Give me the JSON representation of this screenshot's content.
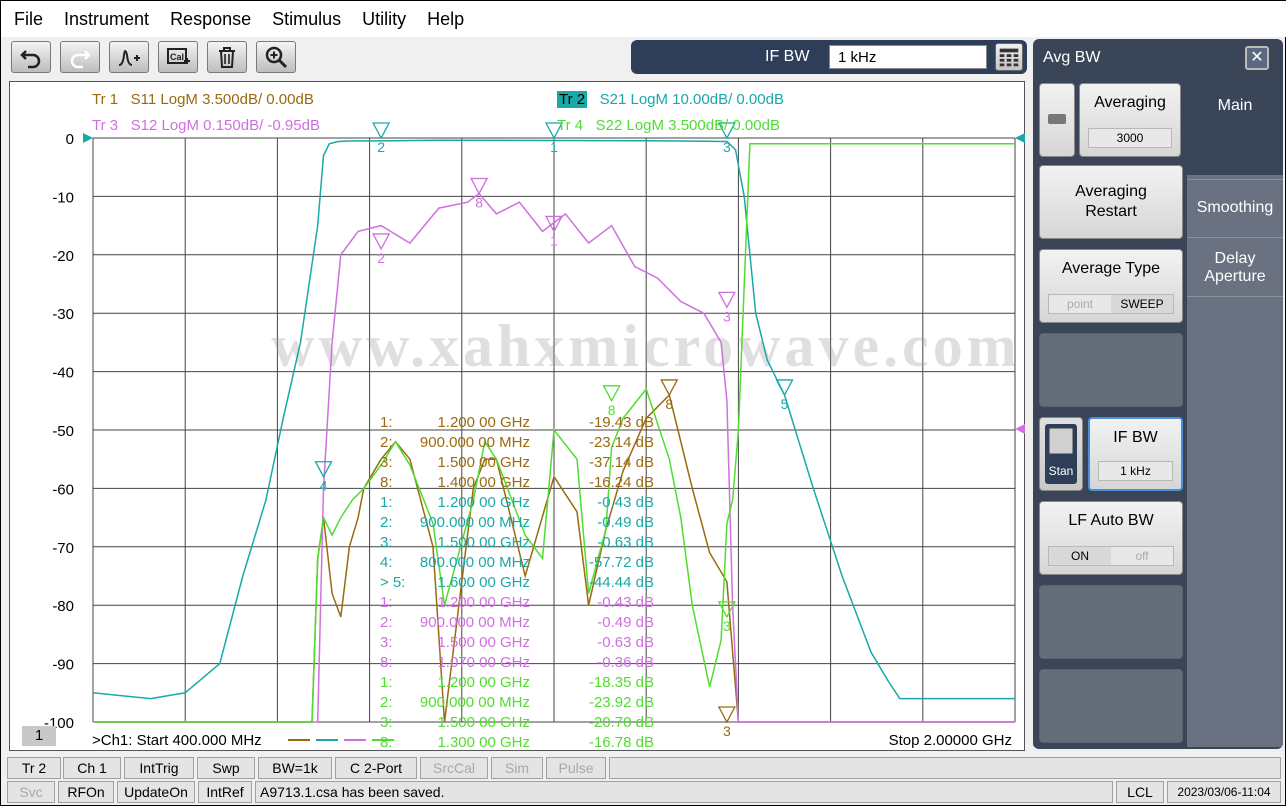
{
  "menu": [
    "File",
    "Instrument",
    "Response",
    "Stimulus",
    "Utility",
    "Help"
  ],
  "toolbar_icons": [
    "undo-icon",
    "redo-icon",
    "marker-add-icon",
    "calibration-icon",
    "trash-icon",
    "zoom-icon"
  ],
  "ifbw_bar": {
    "label": "IF BW",
    "value": "1 kHz"
  },
  "traces": [
    {
      "id": "Tr 1",
      "desc": "S11 LogM 3.500dB/  0.00dB",
      "color": "#9a6a10"
    },
    {
      "id": "Tr 2",
      "desc": "S21 LogM 10.00dB/  0.00dB",
      "color": "#1aa8a8"
    },
    {
      "id": "Tr 3",
      "desc": "S12 LogM 0.150dB/  -0.95dB",
      "color": "#d070e0"
    },
    {
      "id": "Tr 4",
      "desc": "S22 LogM 3.500dB/  0.00dB",
      "color": "#50dd30"
    }
  ],
  "watermark": "www.xahxmicrowave.com",
  "channel_box": "1",
  "start_label": ">Ch1:  Start  400.000 MHz",
  "stop_label": "Stop  2.00000 GHz",
  "marker_table": [
    {
      "n": "1:",
      "f": "1.200 00 GHz",
      "v": "-19.43 dB",
      "color": "#9a6a10"
    },
    {
      "n": "2:",
      "f": "900.000 00 MHz",
      "v": "-23.14 dB",
      "color": "#9a6a10"
    },
    {
      "n": "3:",
      "f": "1.500 00 GHz",
      "v": "-37.14 dB",
      "color": "#9a6a10"
    },
    {
      "n": "8:",
      "f": "1.400 00 GHz",
      "v": "-16.24 dB",
      "color": "#9a6a10"
    },
    {
      "n": "1:",
      "f": "1.200 00 GHz",
      "v": "-0.43 dB",
      "color": "#1aa8a8"
    },
    {
      "n": "2:",
      "f": "900.000 00 MHz",
      "v": "-0.49 dB",
      "color": "#1aa8a8"
    },
    {
      "n": "3:",
      "f": "1.500 00 GHz",
      "v": "-0.63 dB",
      "color": "#1aa8a8"
    },
    {
      "n": "4:",
      "f": "800.000 00 MHz",
      "v": "-57.72 dB",
      "color": "#1aa8a8"
    },
    {
      "n": "> 5:",
      "f": "1.600 00 GHz",
      "v": "-44.44 dB",
      "color": "#1aa8a8"
    },
    {
      "n": "1:",
      "f": "1.200 00 GHz",
      "v": "-0.43 dB",
      "color": "#d070e0"
    },
    {
      "n": "2:",
      "f": "900.000 00 MHz",
      "v": "-0.49 dB",
      "color": "#d070e0"
    },
    {
      "n": "3:",
      "f": "1.500 00 GHz",
      "v": "-0.63 dB",
      "color": "#d070e0"
    },
    {
      "n": "8:",
      "f": "1.070 00 GHz",
      "v": "-0.36 dB",
      "color": "#d070e0"
    },
    {
      "n": "1:",
      "f": "1.200 00 GHz",
      "v": "-18.35 dB",
      "color": "#50dd30"
    },
    {
      "n": "2:",
      "f": "900.000 00 MHz",
      "v": "-23.92 dB",
      "color": "#50dd30"
    },
    {
      "n": "3:",
      "f": "1.500 00 GHz",
      "v": "-20.70 dB",
      "color": "#50dd30"
    },
    {
      "n": "8:",
      "f": "1.300 00 GHz",
      "v": "-16.78 dB",
      "color": "#50dd30"
    }
  ],
  "right_panel": {
    "title": "Avg BW",
    "softkeys": {
      "averaging": {
        "label": "Averaging",
        "value": "3000"
      },
      "averaging_restart": {
        "line1": "Averaging",
        "line2": "Restart"
      },
      "average_type": {
        "label": "Average Type",
        "opt1": "point",
        "opt2": "SWEEP"
      },
      "stan": "Stan",
      "if_bw": {
        "label": "IF BW",
        "value": "1 kHz"
      },
      "lf_auto_bw": {
        "label": "LF Auto BW",
        "opt1": "ON",
        "opt2": "off"
      }
    },
    "tabs": {
      "main": "Main",
      "smoothing": "Smoothing",
      "delay1": "Delay",
      "delay2": "Aperture"
    }
  },
  "status_row1": [
    "Tr 2",
    "Ch 1",
    "IntTrig",
    "Swp",
    "BW=1k",
    "C  2-Port",
    "SrcCal",
    "Sim",
    "Pulse"
  ],
  "status_row2": [
    "Svc",
    "RFOn",
    "UpdateOn",
    "IntRef",
    "A9713.1.csa has been saved.",
    "LCL",
    "2023/03/06-11:04"
  ],
  "chart_data": {
    "type": "line",
    "x_unit": "MHz",
    "xlim": [
      400,
      2000
    ],
    "ylim": [
      -100,
      0
    ],
    "y_ticks": [
      0,
      -10,
      -20,
      -30,
      -40,
      -50,
      -60,
      -70,
      -80,
      -90,
      -100
    ],
    "grid": true,
    "series": [
      {
        "trace": "Tr 1",
        "x": [
          400,
          780,
          790,
          800,
          815,
          830,
          845,
          860,
          870,
          900,
          925,
          950,
          990,
          1010,
          1060,
          1080,
          1100,
          1150,
          1200,
          1240,
          1260,
          1290,
          1320,
          1360,
          1400,
          1440,
          1470,
          1500,
          1510,
          1520,
          1560,
          2000
        ],
        "y": [
          -100,
          -100,
          -72,
          -65,
          -78,
          -82,
          -70,
          -65,
          -60,
          -55,
          -52,
          -55,
          -70,
          -100,
          -60,
          -55,
          -55,
          -75,
          -58,
          -64,
          -80,
          -67,
          -57,
          -48,
          -44,
          -60,
          -71,
          -76,
          -88,
          -100,
          -100,
          -100
        ]
      },
      {
        "trace": "Tr 2",
        "x": [
          400,
          500,
          560,
          620,
          660,
          700,
          730,
          760,
          790,
          800,
          810,
          825,
          850,
          900,
          1000,
          1200,
          1400,
          1500,
          1515,
          1530,
          1550,
          1570,
          1600,
          1650,
          1700,
          1750,
          1780,
          1800,
          2000
        ],
        "y": [
          -95,
          -96,
          -95,
          -90,
          -75,
          -62,
          -48,
          -35,
          -15,
          -3,
          -1,
          -0.6,
          -0.5,
          -0.5,
          -0.4,
          -0.43,
          -0.5,
          -0.6,
          -2,
          -10,
          -30,
          -38,
          -44,
          -60,
          -75,
          -88,
          -93,
          -96,
          -96
        ]
      },
      {
        "trace": "Tr 3",
        "x": [
          400,
          790,
          800,
          815,
          830,
          860,
          900,
          950,
          1000,
          1050,
          1070,
          1100,
          1140,
          1180,
          1220,
          1260,
          1300,
          1340,
          1380,
          1420,
          1460,
          1490,
          1500,
          1510,
          1520,
          2000
        ],
        "y": [
          -100,
          -100,
          -60,
          -35,
          -20,
          -16,
          -15,
          -18,
          -12,
          -11,
          -9.5,
          -13,
          -11,
          -16,
          -13,
          -18,
          -15,
          -22,
          -24,
          -28,
          -30,
          -35,
          -45,
          -80,
          -100,
          -100
        ]
      },
      {
        "trace": "Tr 4",
        "x": [
          400,
          780,
          790,
          800,
          815,
          830,
          850,
          870,
          900,
          925,
          950,
          990,
          1010,
          1060,
          1080,
          1100,
          1150,
          1180,
          1200,
          1240,
          1260,
          1290,
          1300,
          1320,
          1360,
          1400,
          1420,
          1440,
          1470,
          1490,
          1500,
          1510,
          1520,
          1540,
          2000
        ],
        "y": [
          -100,
          -100,
          -72,
          -65,
          -68,
          -65,
          -62,
          -60,
          -56,
          -52,
          -56,
          -66,
          -80,
          -62,
          -52,
          -55,
          -68,
          -72,
          -50,
          -55,
          -78,
          -67,
          -53,
          -48,
          -43,
          -55,
          -65,
          -80,
          -94,
          -86,
          -66,
          -62,
          -50,
          -1,
          -1
        ]
      }
    ],
    "markers": [
      {
        "trace": "Tr 1",
        "labels": [
          "8"
        ],
        "x": [
          1400
        ],
        "y": [
          -44
        ]
      },
      {
        "trace": "Tr 1",
        "labels": [
          "3"
        ],
        "x": [
          1500
        ],
        "y": [
          -100
        ]
      },
      {
        "trace": "Tr 2",
        "labels": [
          "1",
          "2",
          "3"
        ],
        "x": [
          1200,
          900,
          1500
        ],
        "y": [
          0,
          0,
          0
        ]
      },
      {
        "trace": "Tr 2",
        "labels": [
          "4",
          "5"
        ],
        "x": [
          800,
          1600
        ],
        "y": [
          -58,
          -44
        ]
      },
      {
        "trace": "Tr 3",
        "labels": [
          "8",
          "1",
          "2",
          "3"
        ],
        "x": [
          1070,
          1200,
          900,
          1500
        ],
        "y": [
          -9.5,
          -16,
          -19,
          -29
        ]
      },
      {
        "trace": "Tr 4",
        "labels": [
          "8"
        ],
        "x": [
          1300
        ],
        "y": [
          -45
        ]
      },
      {
        "trace": "Tr 4",
        "labels": [
          "3"
        ],
        "x": [
          1500
        ],
        "y": [
          -82
        ]
      }
    ]
  }
}
